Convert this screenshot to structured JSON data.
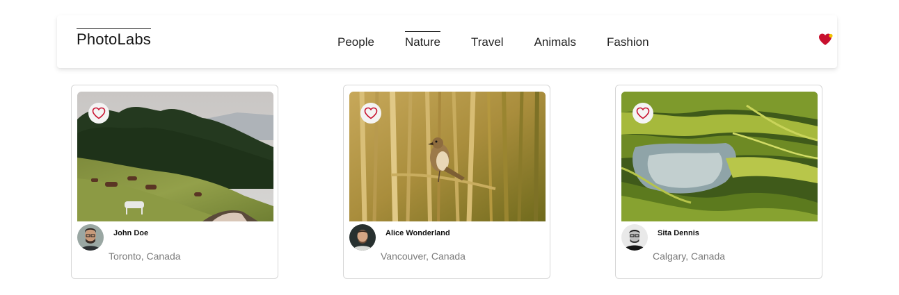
{
  "app": {
    "logo": "PhotoLabs"
  },
  "nav": {
    "topics": [
      {
        "label": "People",
        "active": false
      },
      {
        "label": "Nature",
        "active": true
      },
      {
        "label": "Travel",
        "active": false
      },
      {
        "label": "Animals",
        "active": false
      },
      {
        "label": "Fashion",
        "active": false
      }
    ],
    "fav_icon": "heart-notification-icon",
    "fav_color": "#c8102e",
    "fav_dot_color": "#f2c200"
  },
  "photos": [
    {
      "user": "John Doe",
      "location": "Toronto, Canada",
      "scene": "horses grazing on hillside"
    },
    {
      "user": "Alice Wonderland",
      "location": "Vancouver, Canada",
      "scene": "bird on reeds"
    },
    {
      "user": "Sita Dennis",
      "location": "Calgary, Canada",
      "scene": "rice terraces"
    }
  ],
  "like_icon": "heart-outline-icon",
  "like_color": "#c8102e"
}
